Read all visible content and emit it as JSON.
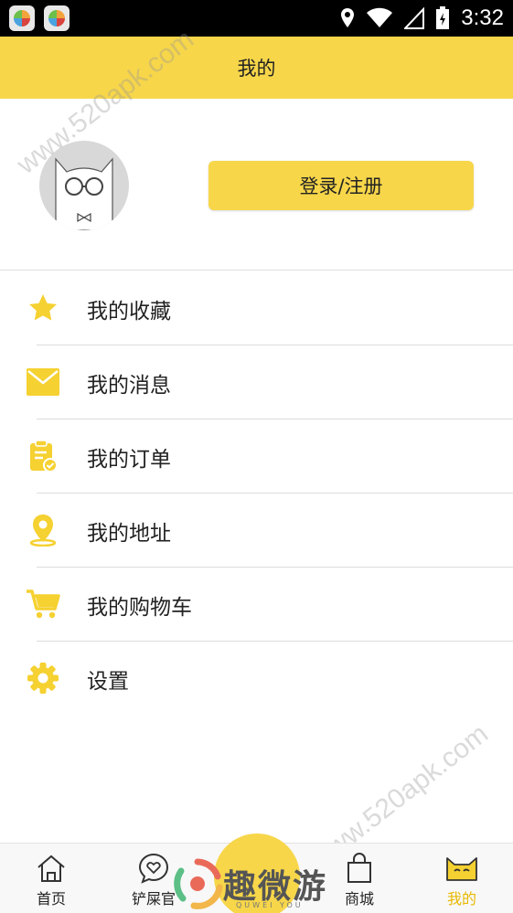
{
  "status_bar": {
    "time": "3:32"
  },
  "header": {
    "title": "我的"
  },
  "profile": {
    "login_label": "登录/注册"
  },
  "menu": {
    "items": [
      {
        "label": "我的收藏",
        "icon": "star-icon"
      },
      {
        "label": "我的消息",
        "icon": "envelope-icon"
      },
      {
        "label": "我的订单",
        "icon": "clipboard-icon"
      },
      {
        "label": "我的地址",
        "icon": "location-pin-icon"
      },
      {
        "label": "我的购物车",
        "icon": "cart-icon"
      },
      {
        "label": "设置",
        "icon": "gear-icon"
      }
    ]
  },
  "bottom_nav": {
    "items": [
      {
        "label": "首页",
        "icon": "home-icon"
      },
      {
        "label": "铲屎官",
        "icon": "heart-chat-icon"
      },
      {
        "label": "商城",
        "icon": "shopping-bag-icon"
      },
      {
        "label": "我的",
        "icon": "cat-face-icon",
        "active": true
      }
    ]
  },
  "watermark": {
    "text": "www.520apk.com"
  },
  "brand_overlay": {
    "text": "趣微游",
    "sub": "QUWEI YOU"
  },
  "colors": {
    "accent": "#f7d64a",
    "active_text": "#e8b800"
  }
}
